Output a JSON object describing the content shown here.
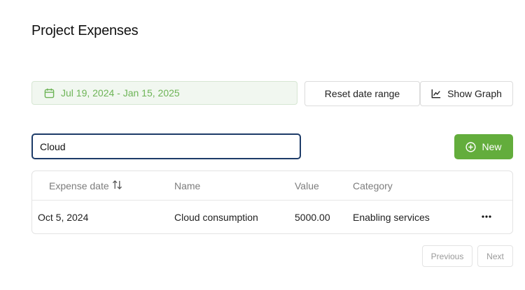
{
  "page": {
    "title": "Project Expenses"
  },
  "toolbar": {
    "date_range": "Jul 19, 2024 - Jan 15, 2025",
    "reset_label": "Reset date range",
    "graph_label": "Show Graph"
  },
  "search": {
    "value": "Cloud"
  },
  "new_button": {
    "label": "New"
  },
  "table": {
    "columns": [
      "Expense date",
      "Name",
      "Value",
      "Category"
    ],
    "rows": [
      {
        "date": "Oct 5, 2024",
        "name": "Cloud consumption",
        "value": "5000.00",
        "category": "Enabling services"
      }
    ]
  },
  "pagination": {
    "previous": "Previous",
    "next": "Next"
  },
  "colors": {
    "accent": "#63ad3c",
    "date_text": "#6db456",
    "focus": "#1d3b68"
  },
  "icons": {
    "date": "calendar-icon",
    "graph": "line-chart-icon",
    "new": "plus-circle-icon",
    "sort": "sort-arrows-icon",
    "row_menu": "ellipsis-icon"
  }
}
